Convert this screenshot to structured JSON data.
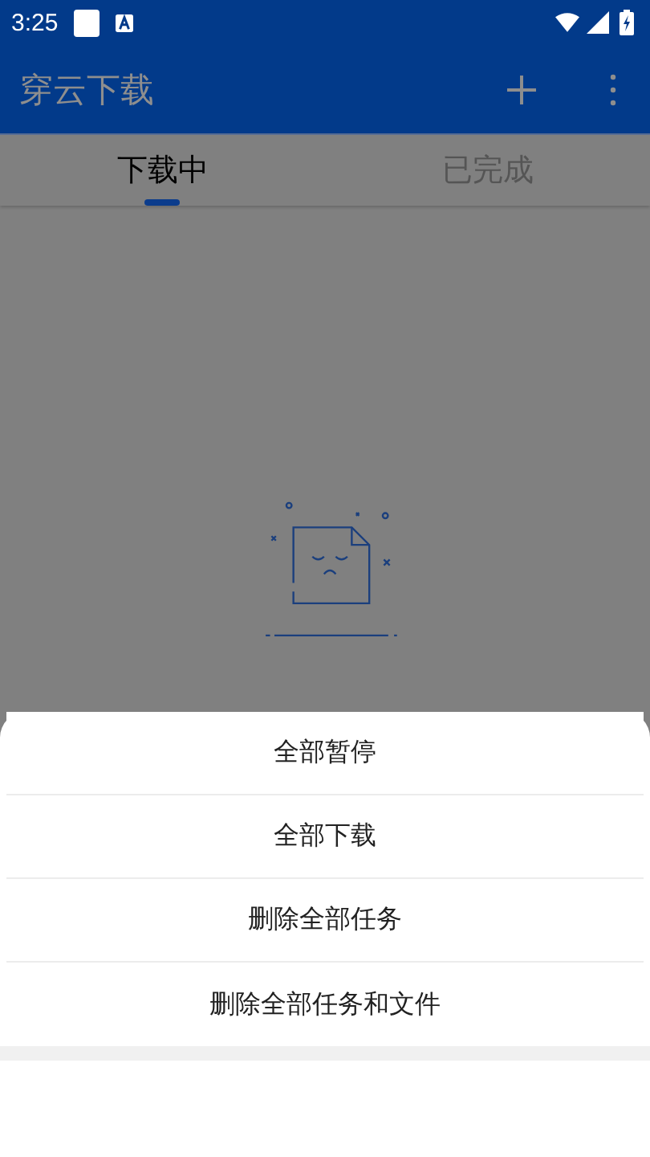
{
  "status_bar": {
    "time": "3:25"
  },
  "app_bar": {
    "title": "穿云下载"
  },
  "tabs": [
    {
      "label": "下载中",
      "selected": true
    },
    {
      "label": "已完成",
      "selected": false
    }
  ],
  "action_sheet": {
    "actions": [
      "全部暂停",
      "全部下载",
      "删除全部任务",
      "删除全部任务和文件"
    ]
  }
}
